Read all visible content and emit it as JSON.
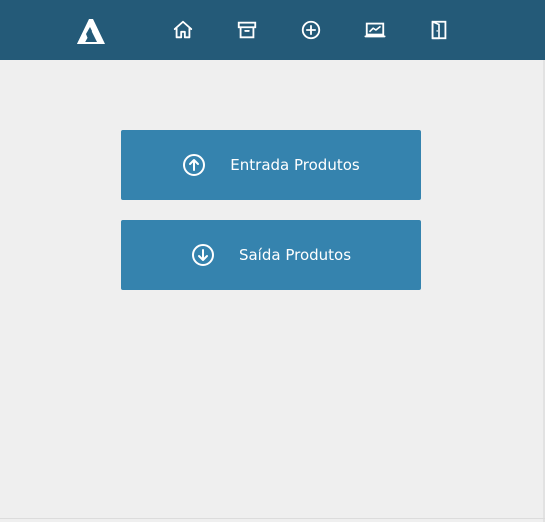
{
  "header": {
    "logo_icon": "app-logo-triangle",
    "nav": [
      {
        "name": "home",
        "icon": "home-icon"
      },
      {
        "name": "archive",
        "icon": "archive-box-icon"
      },
      {
        "name": "add",
        "icon": "plus-circle-icon"
      },
      {
        "name": "reports",
        "icon": "chart-monitor-icon"
      },
      {
        "name": "logout",
        "icon": "door-exit-icon"
      }
    ],
    "background_color": "#245a78"
  },
  "actions": {
    "entrada": {
      "label": "Entrada Produtos",
      "icon": "arrow-up-circle-icon"
    },
    "saida": {
      "label": "Saída Produtos",
      "icon": "arrow-down-circle-icon"
    },
    "button_color": "#3583ae"
  },
  "page_background": "#efefef"
}
